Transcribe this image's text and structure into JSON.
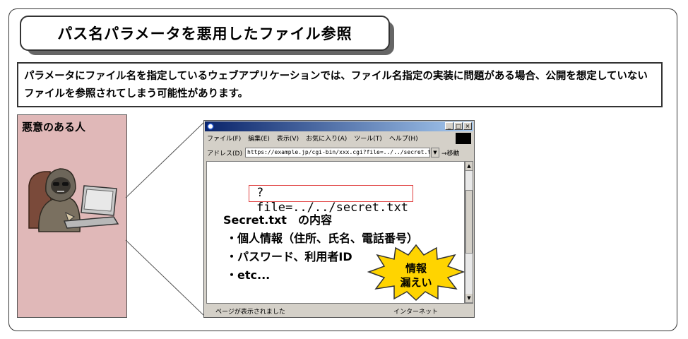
{
  "title": "パス名パラメータを悪用したファイル参照",
  "description": "パラメータにファイル名を指定しているウェブアプリケーションでは、ファイル名指定の実装に問題がある場合、公開を想定していないファイルを参照されてしまう可能性があります。",
  "attacker": {
    "label": "悪意のある人"
  },
  "browser": {
    "menu": [
      "ファイル(F)",
      "編集(E)",
      "表示(V)",
      "お気に入り(A)",
      "ツール(T)",
      "ヘルプ(H)"
    ],
    "address_label": "アドレス(D)",
    "address_value": "https://example.jp/cgi-bin/xxx.cgi?file=../../secret.txt",
    "go_label": "移動",
    "status_text": "ページが表示されました",
    "status_zone": "インターネット"
  },
  "parameter": "?file=../../secret.txt",
  "secret": {
    "title": "Secret.txt　の内容",
    "items": [
      "・個人情報（住所、氏名、電話番号）",
      "・パスワード、利用者ID",
      "・etc..."
    ]
  },
  "burst": {
    "line1": "情報",
    "line2": "漏えい"
  },
  "colors": {
    "person_panel": "#e0b8b8",
    "highlight_red": "#e04040",
    "burst_fill": "#ffd400"
  }
}
